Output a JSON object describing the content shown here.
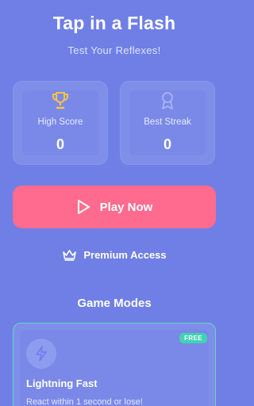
{
  "header": {
    "title": "Tap in a Flash",
    "subtitle": "Test Your Reflexes!"
  },
  "stats": {
    "high_score": {
      "label": "High Score",
      "value": "0",
      "icon": "trophy-icon"
    },
    "best_streak": {
      "label": "Best Streak",
      "value": "0",
      "icon": "medal-icon"
    }
  },
  "play_button": {
    "label": "Play Now",
    "icon": "play-icon"
  },
  "premium": {
    "label": "Premium Access",
    "icon": "crown-icon"
  },
  "game_modes": {
    "title": "Game Modes",
    "modes": [
      {
        "name": "Lightning Fast",
        "description": "React within 1 second or lose!",
        "badge": "FREE",
        "icon": "lightning-icon"
      }
    ]
  },
  "colors": {
    "background": "#6f7fe6",
    "card": "#7f8ee9",
    "primary_button": "#ff6b8e",
    "trophy": "#f5c542",
    "badge": "#3fd3b3",
    "highlight_border": "#5fd9c4"
  }
}
